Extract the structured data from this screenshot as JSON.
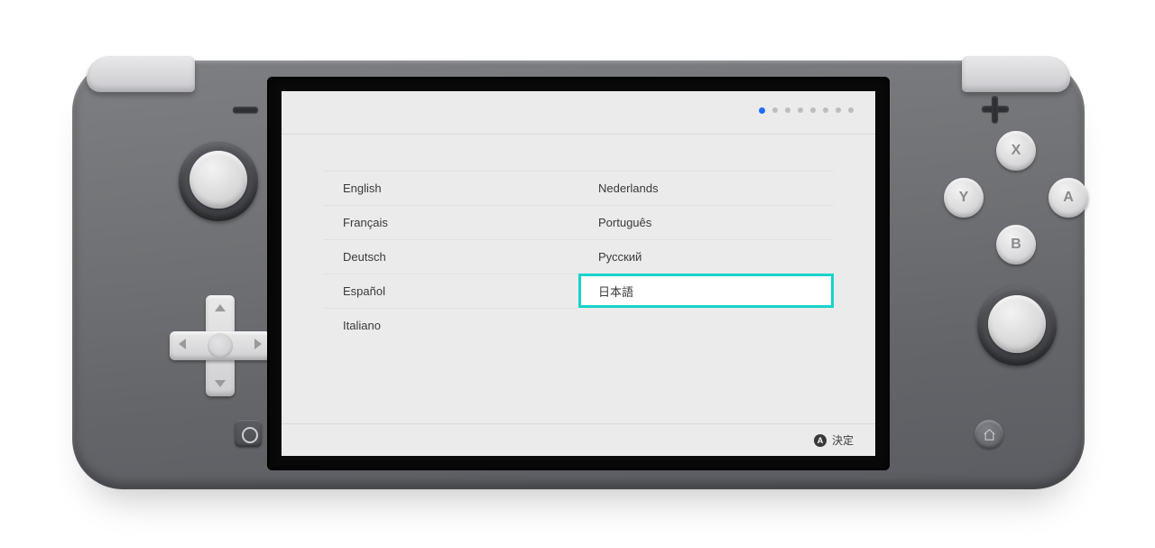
{
  "setup": {
    "step_count": 8,
    "step_active_index": 0,
    "languages_col1": [
      {
        "label": "English"
      },
      {
        "label": "Français"
      },
      {
        "label": "Deutsch"
      },
      {
        "label": "Español"
      },
      {
        "label": "Italiano"
      }
    ],
    "languages_col2": [
      {
        "label": "Nederlands"
      },
      {
        "label": "Português"
      },
      {
        "label": "Русский"
      },
      {
        "label": "日本語"
      }
    ],
    "selected_language_label": "日本語",
    "footer": {
      "confirm_glyph": "A",
      "confirm_label": "決定"
    }
  },
  "controller": {
    "face_buttons": {
      "x": "X",
      "y": "Y",
      "a": "A",
      "b": "B"
    }
  }
}
